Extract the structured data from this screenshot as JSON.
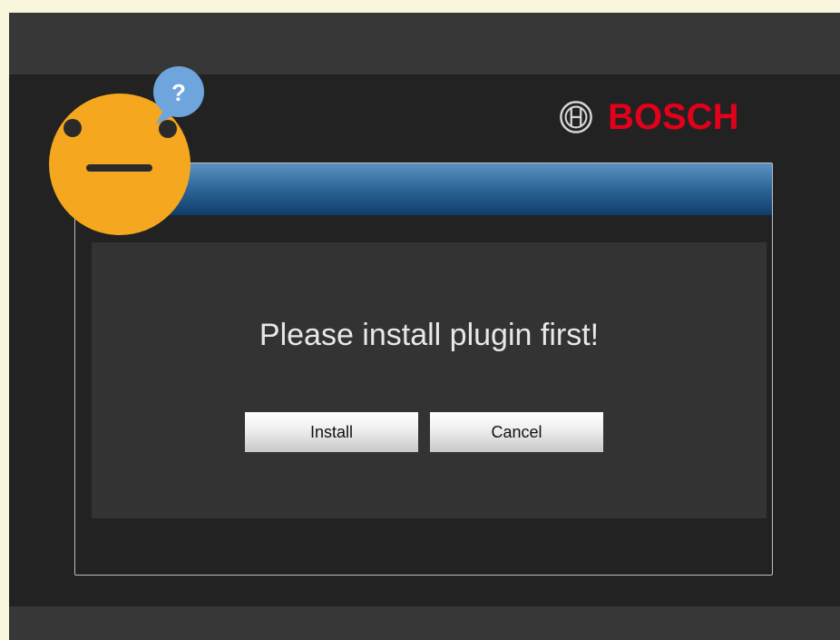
{
  "brand": {
    "name": "BOSCH",
    "color": "#e2001a",
    "icon": "bosch-armature-icon"
  },
  "dialog": {
    "message": "Please install plugin first!",
    "install_label": "Install",
    "cancel_label": "Cancel"
  },
  "overlay": {
    "icon": "confused-face-icon",
    "badge_text": "?",
    "face_color": "#f5a71f",
    "badge_color": "#6fa5dd"
  }
}
